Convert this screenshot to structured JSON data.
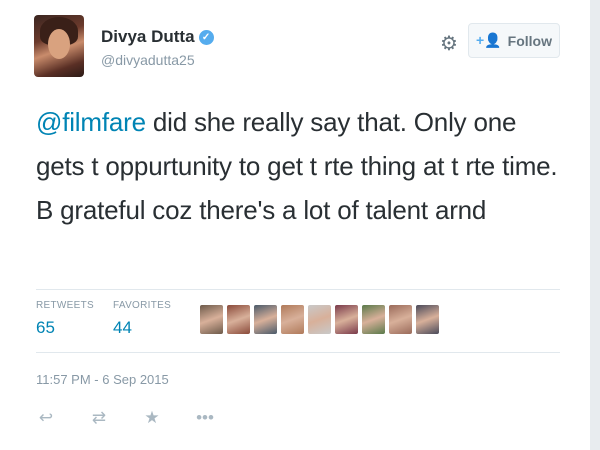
{
  "user": {
    "name": "Divya Dutta",
    "handle": "@divyadutta25",
    "verified_glyph": "✓"
  },
  "follow_button": {
    "label": "Follow",
    "icon": "add-user-icon"
  },
  "tweet": {
    "mention": "@filmfare",
    "text": " did she really say that. Only one gets t oppurtunity to get t rte thing at t rte time. B grateful coz there's a lot of talent arnd"
  },
  "stats": {
    "retweets_label": "RETWEETS",
    "retweets": "65",
    "favorites_label": "FAVORITES",
    "favorites": "44"
  },
  "favoriter_avatars": [
    "#6d5a4a",
    "#8a4a3a",
    "#4a5a6a",
    "#b07a5a",
    "#c9c9c9",
    "#7a3a4a",
    "#5a7a4a",
    "#9a6a5a",
    "#4a4a5a"
  ],
  "timestamp": "11:57 PM - 6 Sep 2015",
  "colors": {
    "link": "#0084b4",
    "verified": "#55acee",
    "muted": "#8899a6"
  }
}
